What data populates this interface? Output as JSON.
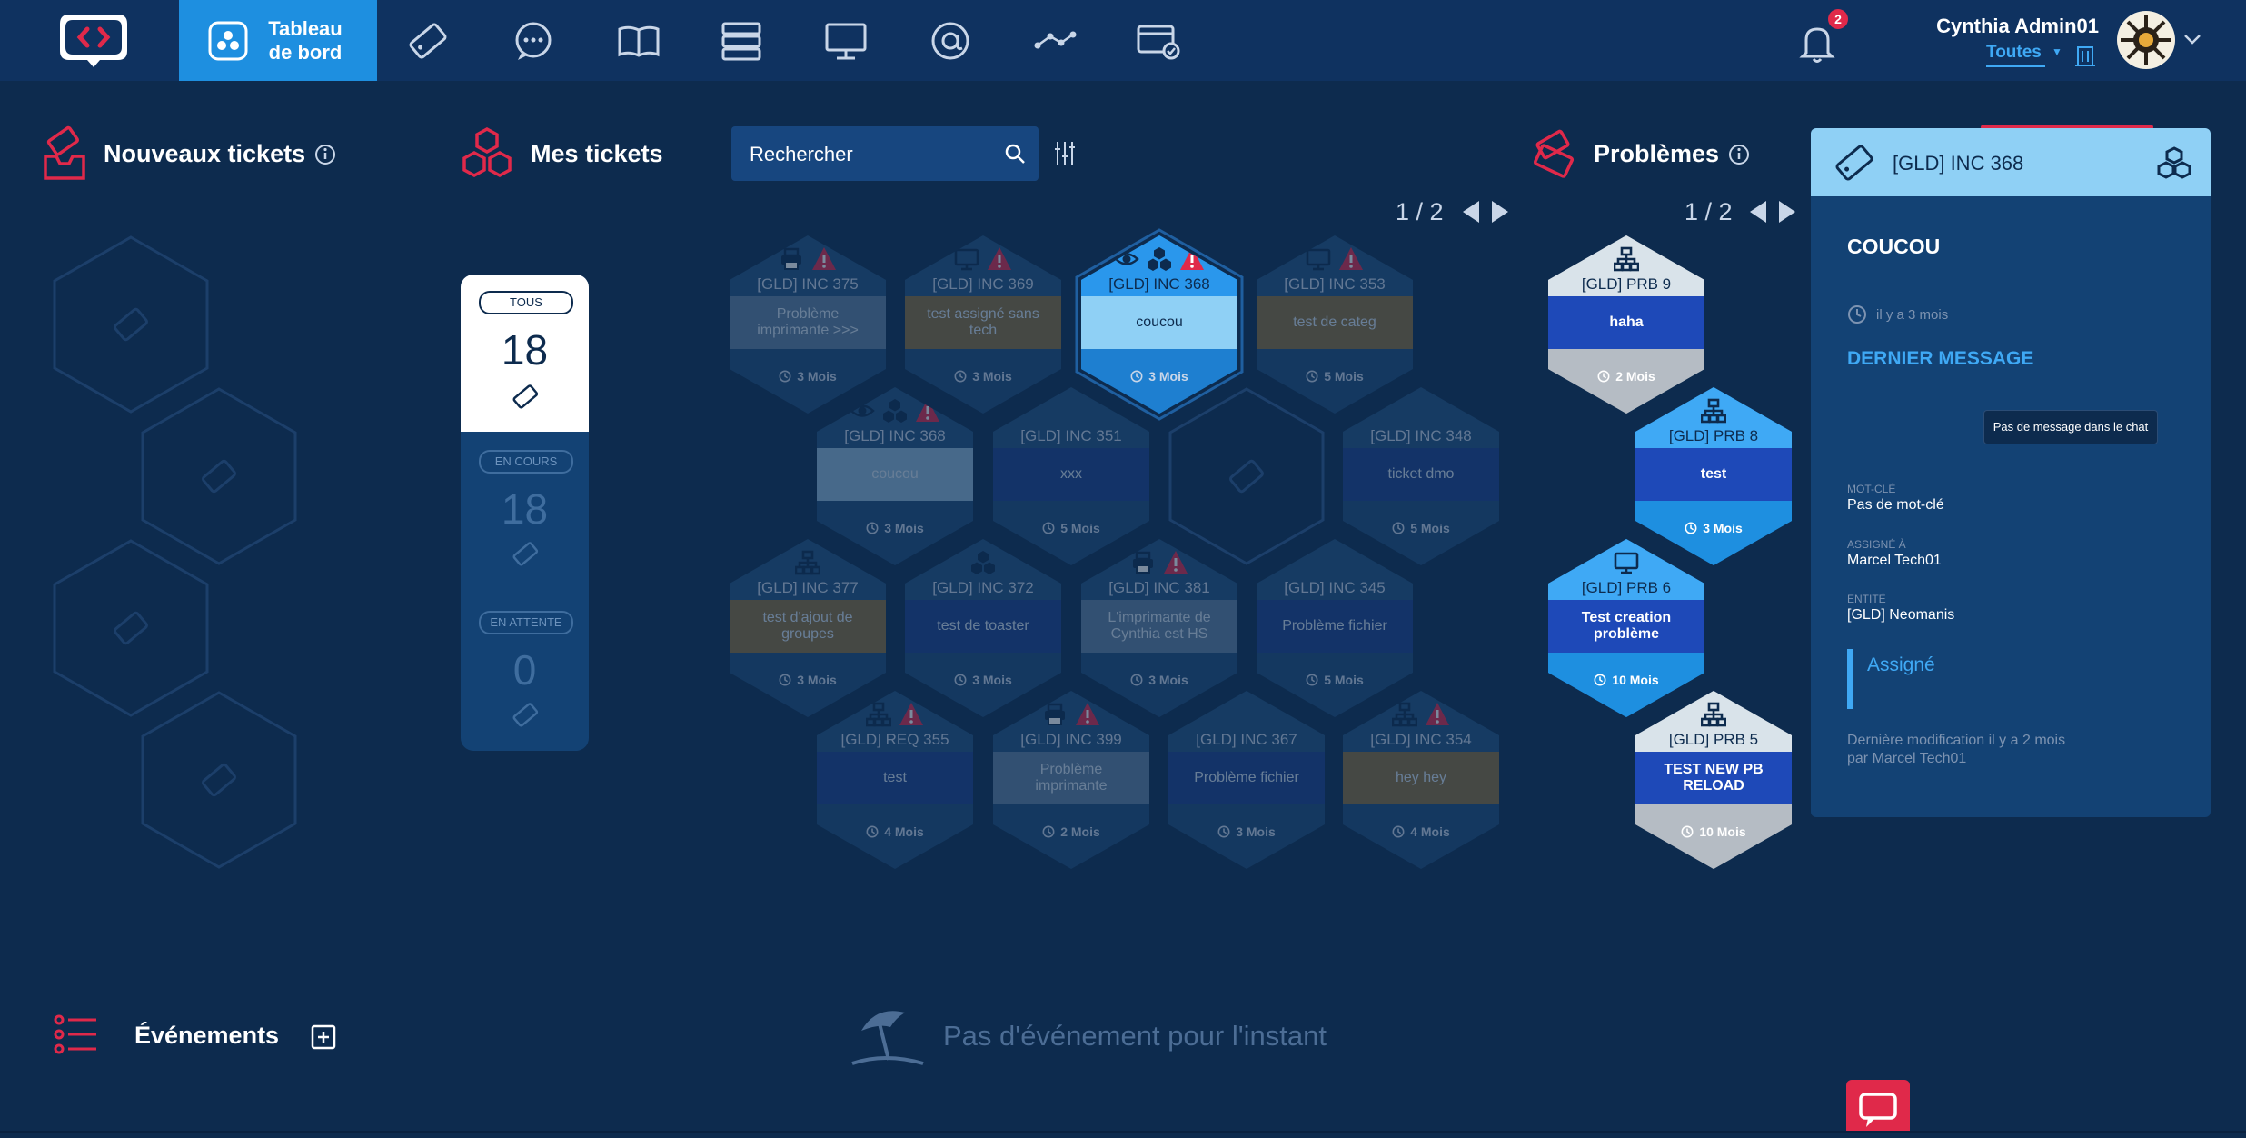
{
  "header": {
    "dashboard_label": "Tableau de bord",
    "nav_icons": [
      "ticket-icon",
      "chat-bubble-icon",
      "book-icon",
      "server-stack-icon",
      "monitor-icon",
      "at-sign-icon",
      "route-icon",
      "billing-icon"
    ],
    "notification_count": "2",
    "user_name": "Cynthia Admin01",
    "entity_filter": "Toutes"
  },
  "sections": {
    "new_tickets": "Nouveaux tickets",
    "my_tickets": "Mes tickets",
    "problems": "Problèmes",
    "events": "Événements"
  },
  "search": {
    "placeholder": "Rechercher"
  },
  "tickets_pager": "1 / 2",
  "problems_pager": "1 / 2",
  "counters": [
    {
      "label": "TOUS",
      "value": "18"
    },
    {
      "label": "EN COURS",
      "value": "18"
    },
    {
      "label": "EN ATTENTE",
      "value": "0"
    }
  ],
  "tickets": [
    {
      "code": "[GLD] INC 375",
      "title": "Problème imprimante >>>",
      "age": "3 Mois",
      "icon": "printer-icon",
      "alert": true
    },
    {
      "code": "[GLD] INC 369",
      "title": "test assigné sans tech",
      "age": "3 Mois",
      "icon": "monitor-icon",
      "alert": true
    },
    {
      "code": "[GLD] INC 368",
      "title": "coucou",
      "age": "3 Mois",
      "icon": "group-icon",
      "alert": true,
      "watched": true,
      "selected": true
    },
    {
      "code": "[GLD] INC 353",
      "title": "test de categ",
      "age": "5 Mois",
      "icon": "monitor-icon",
      "alert": true
    },
    {
      "code": "[GLD] INC 368",
      "title": "coucou",
      "age": "3 Mois",
      "icon": "group-icon",
      "alert": true,
      "watched": true
    },
    {
      "code": "[GLD] INC 351",
      "title": "xxx",
      "age": "5 Mois"
    },
    {
      "code": "[GLD] INC 348",
      "title": "ticket dmo",
      "age": "5 Mois"
    },
    {
      "code": "[GLD] INC 377",
      "title": "test d'ajout de groupes",
      "age": "3 Mois",
      "icon": "network-icon"
    },
    {
      "code": "[GLD] INC 372",
      "title": "test de toaster",
      "age": "3 Mois",
      "icon": "group-icon"
    },
    {
      "code": "[GLD] INC 381",
      "title": "L'imprimante de Cynthia est HS",
      "age": "3 Mois",
      "icon": "printer-icon",
      "alert": true
    },
    {
      "code": "[GLD] INC 345",
      "title": "Problème fichier",
      "age": "5 Mois"
    },
    {
      "code": "[GLD] REQ 355",
      "title": "test",
      "age": "4 Mois",
      "icon": "network-icon",
      "alert": true
    },
    {
      "code": "[GLD] INC 399",
      "title": "Problème imprimante",
      "age": "2 Mois",
      "icon": "printer-icon",
      "alert": true
    },
    {
      "code": "[GLD] INC 367",
      "title": "Problème fichier",
      "age": "3 Mois"
    },
    {
      "code": "[GLD] INC 354",
      "title": "hey hey",
      "age": "4 Mois",
      "icon": "network-icon",
      "alert": true
    }
  ],
  "problems": [
    {
      "code": "[GLD] PRB 9",
      "title": "haha",
      "age": "2 Mois",
      "icon": "network-icon"
    },
    {
      "code": "[GLD] PRB 8",
      "title": "test",
      "age": "3 Mois",
      "icon": "network-icon"
    },
    {
      "code": "[GLD] PRB 6",
      "title": "Test creation problème",
      "age": "10 Mois",
      "icon": "monitor-icon"
    },
    {
      "code": "[GLD] PRB 5",
      "title": "TEST NEW PB RELOAD",
      "age": "10 Mois",
      "icon": "network-icon"
    }
  ],
  "panel": {
    "ticket_code": "[GLD] INC 368",
    "name": "COUCOU",
    "time": "il y a 3 mois",
    "last_message_title": "DERNIER MESSAGE",
    "no_message": "Pas de message dans le chat",
    "keyword_label": "MOT-CLÉ",
    "keyword_value": "Pas de mot-clé",
    "assigned_label": "ASSIGNÉ À",
    "assigned_value": "Marcel Tech01",
    "entity_label": "ENTITÉ",
    "entity_value": "[GLD] Neomanis",
    "status": "Assigné",
    "modified_line1": "Dernière modification il y a 2 mois",
    "modified_line2": "par Marcel Tech01"
  },
  "events": {
    "empty": "Pas d'événement pour l'instant"
  },
  "colors": {
    "background": "#0d2b4e",
    "topbar": "#0f3260",
    "accent_blue": "#1e8fe0",
    "accent_red": "#e0294a",
    "link_blue": "#3fa9f5",
    "category_brown": "#8a6d3b"
  }
}
